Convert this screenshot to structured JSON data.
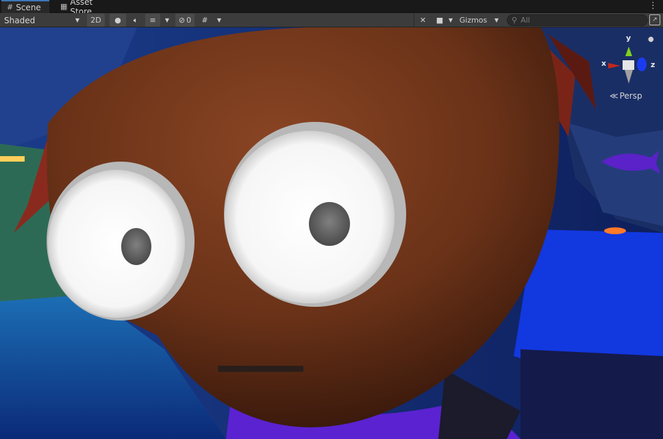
{
  "tabs": [
    {
      "label": "Scene",
      "icon": "grid-icon",
      "active": true
    },
    {
      "label": "Asset Store",
      "icon": "bag-icon",
      "active": false
    }
  ],
  "toolbar": {
    "draw_mode": "Shaded",
    "mode_2d": "2D",
    "hidden_count": "0",
    "gizmos_label": "Gizmos",
    "search_placeholder": "All"
  },
  "gizmo": {
    "x_label": "x",
    "y_label": "y",
    "z_label": "z",
    "projection": "Persp"
  },
  "colors": {
    "accent": "#3a79bb",
    "toolbar_bg": "#3c3c3c",
    "x_axis": "#c1281b",
    "y_axis": "#7fd11b",
    "z_axis": "#1a3cf0",
    "character_skin": "#7a3d1e"
  }
}
